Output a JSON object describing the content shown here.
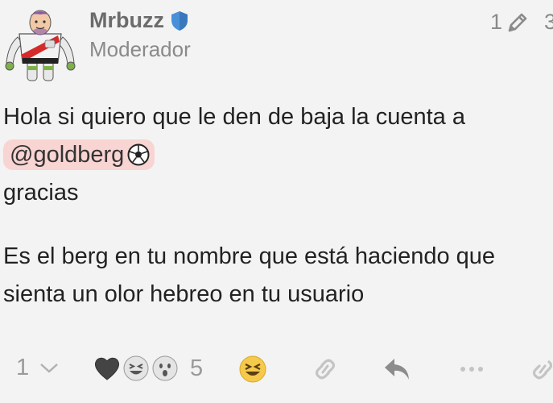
{
  "post": {
    "username": "Mrbuzz",
    "user_title": "Moderador",
    "edit_count": "1",
    "paragraph1_text": "Hola si quiero que le den de baja la cuenta a",
    "mention": "@goldberg",
    "paragraph1_end": "gracias",
    "paragraph2": "Es el berg en tu nombre que está haciendo que sienta un olor hebreo en tu usuario"
  },
  "actions": {
    "replies_count": "1",
    "reactions_count": "5"
  },
  "colors": {
    "background": "#f3f3f3",
    "mention_bg": "#f8d4d2",
    "moderator_shield": "#4a90d9",
    "muted_text": "#8a8a8a"
  },
  "icons": [
    "moderator-shield-icon",
    "pencil-icon",
    "chevron-down-icon",
    "black-heart-icon",
    "laughing-emoji-icon",
    "surprised-emoji-icon",
    "soccer-ball-icon",
    "link-icon",
    "reply-icon",
    "more-icon"
  ]
}
